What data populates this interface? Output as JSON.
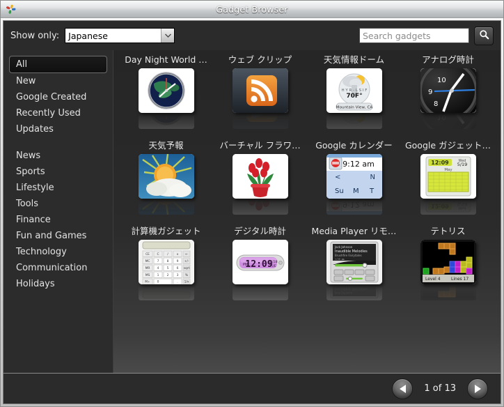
{
  "window": {
    "title": "Gadget Browser",
    "app_icon": "gadgets-pinwheel-icon"
  },
  "toolbar": {
    "show_only_label": "Show only:",
    "language_select": {
      "value": "Japanese",
      "options": [
        "Japanese"
      ],
      "icon": "chevron-down-icon"
    },
    "search": {
      "value": "",
      "placeholder": "Search gadgets",
      "button_icon": "search-icon"
    }
  },
  "sidebar": {
    "items": [
      {
        "label": "All",
        "selected": true
      },
      {
        "label": "New",
        "selected": false
      },
      {
        "label": "Google Created",
        "selected": false
      },
      {
        "label": "Recently Used",
        "selected": false
      },
      {
        "label": "Updates",
        "selected": false
      },
      {
        "label": "News",
        "selected": false
      },
      {
        "label": "Sports",
        "selected": false
      },
      {
        "label": "Lifestyle",
        "selected": false
      },
      {
        "label": "Tools",
        "selected": false
      },
      {
        "label": "Finance",
        "selected": false
      },
      {
        "label": "Fun and Games",
        "selected": false
      },
      {
        "label": "Technology",
        "selected": false
      },
      {
        "label": "Communication",
        "selected": false
      },
      {
        "label": "Holidays",
        "selected": false
      }
    ],
    "group_break_after_index": 4
  },
  "gadgets": [
    {
      "label": "Day Night World …",
      "thumb": "world-clock-thumb"
    },
    {
      "label": "ウェブ クリップ",
      "thumb": "rss-feed-thumb"
    },
    {
      "label": "天気情報ドーム",
      "thumb": "weather-dome-thumb"
    },
    {
      "label": "アナログ時計",
      "thumb": "analog-clock-thumb"
    },
    {
      "label": "天気予報",
      "thumb": "weather-forecast-thumb"
    },
    {
      "label": "バーチャル フラワ…",
      "thumb": "virtual-flower-thumb"
    },
    {
      "label": "Google カレンダー",
      "thumb": "google-calendar-thumb"
    },
    {
      "label": "Google ガジェット…",
      "thumb": "google-gadget-calendar-thumb"
    },
    {
      "label": "計算機ガジェット",
      "thumb": "calculator-thumb"
    },
    {
      "label": "デジタル時計",
      "thumb": "digital-clock-thumb"
    },
    {
      "label": "Media Player リモ…",
      "thumb": "media-player-thumb"
    },
    {
      "label": "テトリス",
      "thumb": "tetris-thumb"
    }
  ],
  "thumb_text": {
    "weather_dome_temp": "70F°",
    "weather_dome_city": "Mountain View, CA",
    "calendar_time": "9:12 am",
    "calendar_days": [
      "Su",
      "M",
      "T"
    ],
    "calendar_nav_prev": "<",
    "calendar_nav_next": "N",
    "gadget_calendar_time": "12:09",
    "gadget_calendar_date": "5/19",
    "gadget_calendar_month": "May",
    "digital_clock_time": "12:09",
    "digital_clock_meridiem": "PM",
    "digital_clock_date": "12/28",
    "digital_clock_day": "TUE",
    "analog_clock_numerals": [
      "10",
      "9",
      "8"
    ],
    "tetris_level_label": "Level 4",
    "tetris_lines_label": "Lines  17",
    "media_player_track": "Jack Johnson",
    "media_player_album": "Inaudible Melodies"
  },
  "footer": {
    "prev_icon": "triangle-left-icon",
    "next_icon": "triangle-right-icon",
    "page_indicator": "1 of 13",
    "current_page": 1,
    "total_pages": 13
  },
  "colors": {
    "titlebar_text": "#ffffff",
    "panel_background": "#2b2b2b",
    "sidebar_text": "#e3e3e3",
    "accent_orange": "#e8822a",
    "window_frame": "#c8c8c8"
  }
}
